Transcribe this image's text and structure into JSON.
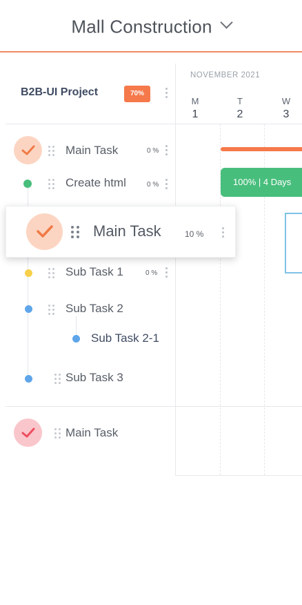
{
  "header": {
    "title": "Mall Construction"
  },
  "project": {
    "name": "B2B-UI Project",
    "progress": "70%"
  },
  "calendar": {
    "month": "NOVEMBER 2021",
    "days": [
      {
        "letter": "M",
        "number": "1"
      },
      {
        "letter": "T",
        "number": "2"
      },
      {
        "letter": "W",
        "number": "3"
      }
    ]
  },
  "tasks": [
    {
      "label": "Main Task",
      "percent": "0 %"
    },
    {
      "label": "Create html",
      "percent": "0 %"
    },
    {
      "label": "Sub Task 1",
      "percent": "0 %"
    },
    {
      "label": "Sub Task 2"
    },
    {
      "label": "Sub Task 2-1"
    },
    {
      "label": "Sub Task 3"
    },
    {
      "label": "Main Task"
    }
  ],
  "dragged_task": {
    "label": "Main Task",
    "percent": "10 %"
  },
  "bars": {
    "green_label": "100% | 4 Days"
  },
  "colors": {
    "accent": "#f5794a",
    "green": "#48be7c",
    "yellow": "#f7cf4a",
    "blue": "#5fa5ea",
    "check_orange": "#f07a46",
    "check_pink": "#ee4d5f"
  }
}
